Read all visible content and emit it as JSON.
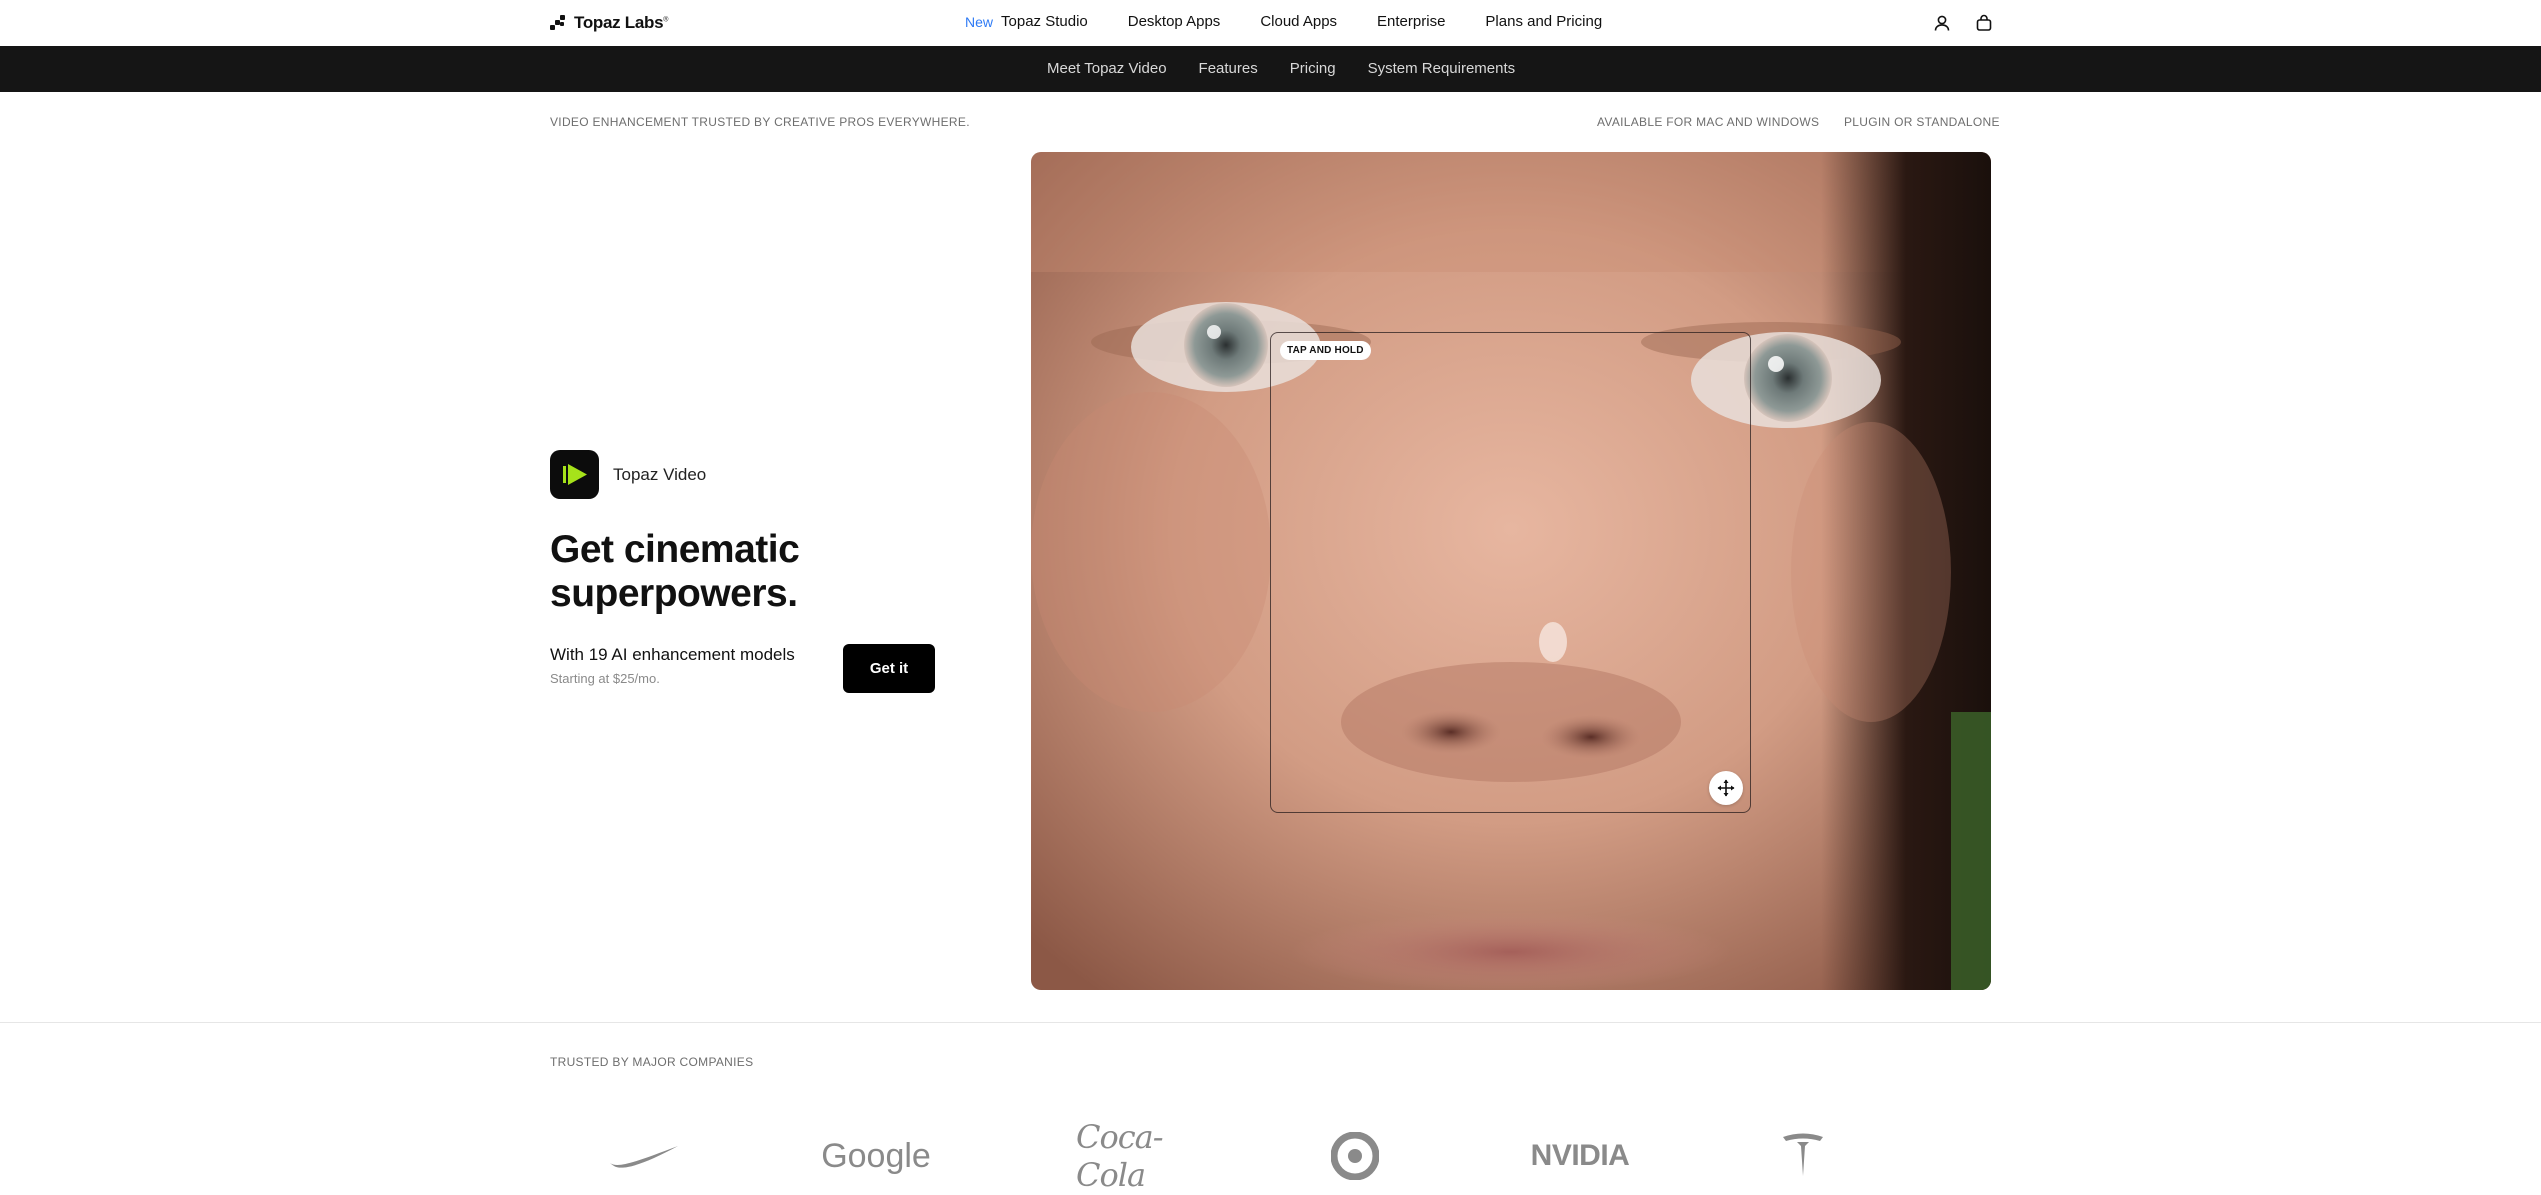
{
  "brand": {
    "name": "Topaz Labs",
    "trademark": "®"
  },
  "topnav": {
    "new_badge": "New",
    "links": [
      "Topaz Studio",
      "Desktop Apps",
      "Cloud Apps",
      "Enterprise",
      "Plans and Pricing"
    ],
    "icons": [
      "account-icon",
      "cart-icon"
    ]
  },
  "subnav": {
    "links": [
      "Meet Topaz Video",
      "Features",
      "Pricing",
      "System Requirements"
    ]
  },
  "trust": {
    "left": "VIDEO ENHANCEMENT TRUSTED BY CREATIVE PROS EVERYWHERE.",
    "right": [
      "AVAILABLE FOR MAC AND WINDOWS",
      "PLUGIN OR STANDALONE"
    ]
  },
  "product": {
    "name": "Topaz Video",
    "headline_line1": "Get cinematic",
    "headline_line2": "superpowers.",
    "subhead": "With 19 AI enhancement models",
    "price_note": "Starting at $25/mo.",
    "cta": "Get it"
  },
  "compare": {
    "pill": "TAP AND HOLD",
    "handle_icon": "move-icon"
  },
  "companies": {
    "label": "TRUSTED BY MAJOR COMPANIES",
    "logos": [
      "Nike",
      "Google",
      "Coca-Cola",
      "Target",
      "NVIDIA",
      "Tesla"
    ],
    "wordmarks": {
      "google": "Google",
      "cocacola": "Coca-Cola",
      "nvidia": "NVIDIA"
    }
  },
  "colors": {
    "accent_new": "#2f7bf5",
    "subnav_bg": "#151515",
    "app_icon_green": "#a6e21a",
    "cta_bg": "#000000"
  }
}
